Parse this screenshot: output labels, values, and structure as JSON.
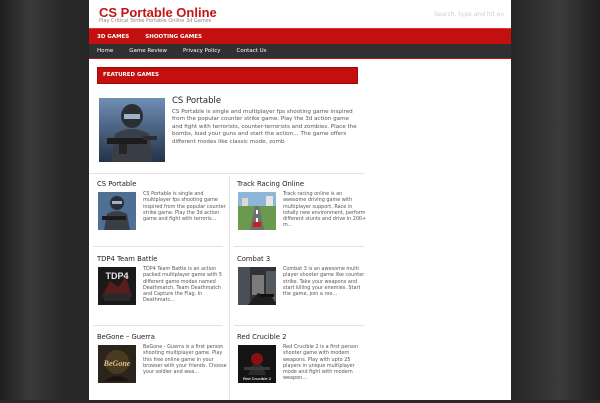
{
  "site": {
    "title": "CS Portable Online",
    "tagline": "Play Critical Strike Portable Online 3d Games",
    "search_placeholder": "Search, type and hit en"
  },
  "nav_primary": [
    "3D GAMES",
    "SHOOTING GAMES"
  ],
  "nav_secondary": [
    "Home",
    "Game Review",
    "Privacy Policy",
    "Contact Us"
  ],
  "featured": {
    "label": "FEATURED GAMES",
    "title": "CS Portable",
    "excerpt": "CS Portable is single and multiplayer fps shooting game inspired from the popular counter strike game. Play the 3d action game and fight with terrorists, counter-terrorists and zombies. Place the bombs, load your guns and start the action… The game offers different modes like classic mode, zomb"
  },
  "posts": [
    {
      "title": "CS Portable",
      "excerpt": "CS Portable is single and multiplayer fps shooting game inspired from the popular counter strike game. Play the 3d action game and fight with terroris…"
    },
    {
      "title": "Track Racing Online",
      "excerpt": "Track racing online is an awesome driving game with multiplayer support. Race in totally new environment, perform different stunts and drive in 200+ m…"
    },
    {
      "title": "TDP4 Team Battle",
      "excerpt": "TDP4 Team Battle is an action packed multiplayer game with 5 different game modes named Deathmatch, Team Deathmatch and Capture the Flag. In Deathmatc…"
    },
    {
      "title": "Combat 3",
      "excerpt": "Combat 3 is an awesome multi player shooter game like counter strike. Take your weapons and start killing your enemies. Start the game, join a roo…"
    },
    {
      "title": "BeGone – Guerra",
      "excerpt": "BeGone - Guerra is a first person shooting multiplayer game. Play this free online game in your browser with your friends. Choose your soldier and wea…"
    },
    {
      "title": "Red Crucible 2",
      "excerpt": "Red Crucible 2 is a first person shooter game with modern weapons. Play with upto 25 players in unique multiplayer mode and fight with modern weapon…"
    }
  ],
  "thumb_texts": {
    "tdp4": "TDP4",
    "begone": "BeGone",
    "red_crucible": "Red Crucible 2"
  },
  "colors": {
    "accent": "#c41414",
    "nav_dark": "#303030"
  }
}
